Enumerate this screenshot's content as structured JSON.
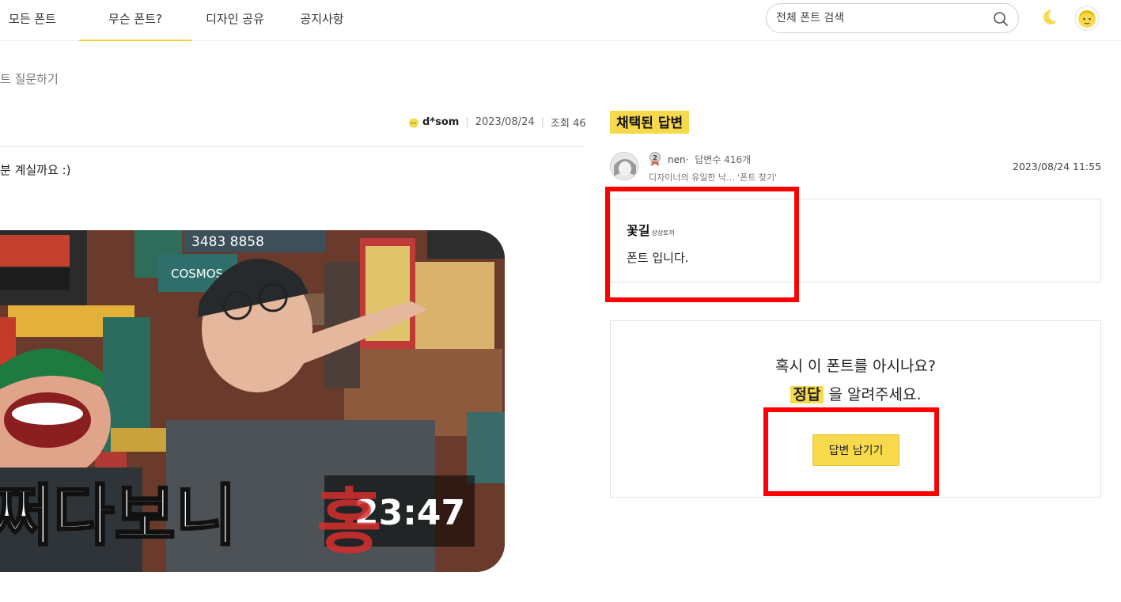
{
  "nav": {
    "items": [
      {
        "label": "모든 폰트",
        "active": false
      },
      {
        "label": "무슨 폰트?",
        "active": true
      },
      {
        "label": "디자인 공유",
        "active": false
      },
      {
        "label": "공지사항",
        "active": false
      }
    ]
  },
  "search": {
    "placeholder": "전체 폰트 검색"
  },
  "breadcrumb": "트 질문하기",
  "post": {
    "author": "d*som",
    "date": "2023/08/24",
    "views": "조회 46",
    "text": "분 계실까요 :)",
    "thumbnail": {
      "duration": "23:47",
      "overlay_text": "쩌다보니",
      "sign_phone": "3483 8858",
      "sign_cosmos": "COSMOS"
    }
  },
  "accepted": {
    "title": "채택된 답변",
    "rank": "2",
    "username": "nen",
    "answer_count": "답변수 416개",
    "bio": "디자이너의 유일한 낙... '폰트 찾기'",
    "date": "2023/08/24 11:55",
    "font_sample_main": "꽃길",
    "font_sample_sub": "상상토끼",
    "font_desc": "폰트 입니다."
  },
  "cta": {
    "line1": "혹시 이 폰트를 아시나요?",
    "highlight": "정답",
    "line2_rest": " 을 알려주세요.",
    "button": "답변 남기기"
  },
  "colors": {
    "accent": "#f7d94c",
    "annotation_red": "#ff0000"
  }
}
